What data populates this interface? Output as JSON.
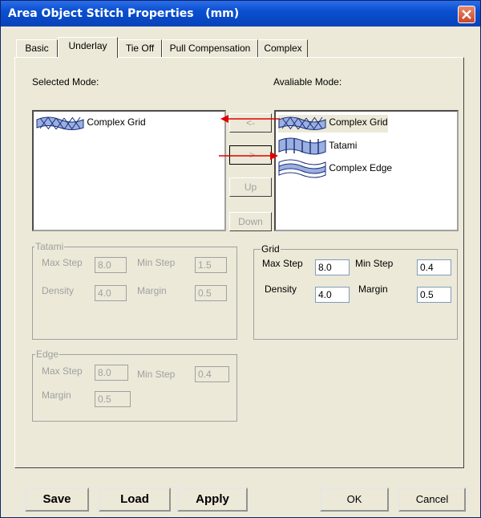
{
  "window": {
    "title": "Area Object Stitch Properties   (mm)"
  },
  "tabs": [
    {
      "label": "Basic"
    },
    {
      "label": "Underlay"
    },
    {
      "label": "Tie Off"
    },
    {
      "label": "Pull Compensation"
    },
    {
      "label": "Complex"
    }
  ],
  "selected_mode": {
    "label": "Selected Mode:",
    "items": [
      {
        "label": "Complex Grid",
        "icon": "complex-grid-icon"
      }
    ]
  },
  "available_mode": {
    "label": "Avaliable Mode:",
    "items": [
      {
        "label": "Complex Grid",
        "icon": "complex-grid-icon"
      },
      {
        "label": "Tatami",
        "icon": "tatami-icon"
      },
      {
        "label": "Complex Edge",
        "icon": "complex-edge-icon"
      }
    ]
  },
  "mode_buttons": {
    "left": "<-",
    "right": "->",
    "up": "Up",
    "down": "Down"
  },
  "tatami": {
    "title": "Tatami",
    "max_step_label": "Max Step",
    "max_step": "8.0",
    "min_step_label": "Min Step",
    "min_step": "1.5",
    "density_label": "Density",
    "density": "4.0",
    "margin_label": "Margin",
    "margin": "0.5"
  },
  "grid": {
    "title": "Grid",
    "max_step_label": "Max Step",
    "max_step": "8.0",
    "min_step_label": "Min Step",
    "min_step": "0.4",
    "density_label": "Density",
    "density": "4.0",
    "margin_label": "Margin",
    "margin": "0.5"
  },
  "edge": {
    "title": "Edge",
    "max_step_label": "Max Step",
    "max_step": "8.0",
    "min_step_label": "Min Step",
    "min_step": "0.4",
    "margin_label": "Margin",
    "margin": "0.5"
  },
  "footer": {
    "save": "Save",
    "load": "Load",
    "apply": "Apply",
    "ok": "OK",
    "cancel": "Cancel"
  },
  "colors": {
    "titlebar": "#0a4fd1",
    "annotation_arrow": "#e00000",
    "dialog_bg": "#ece9d8"
  }
}
